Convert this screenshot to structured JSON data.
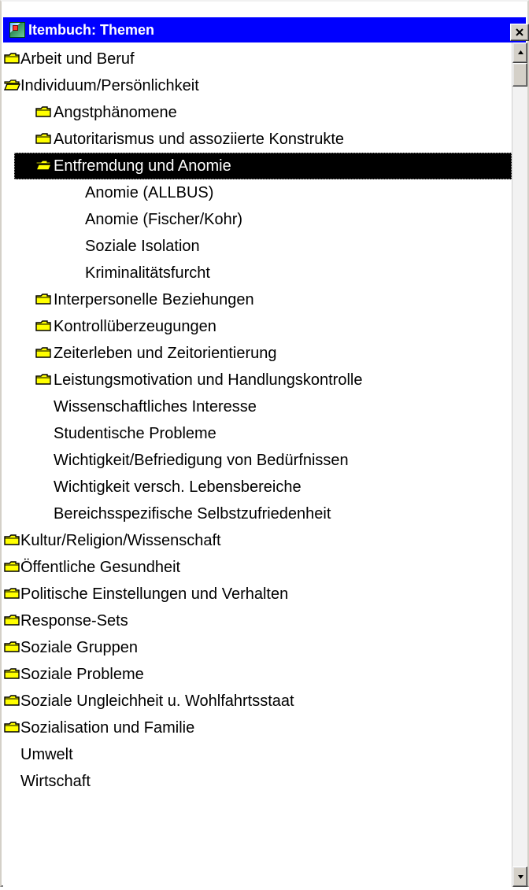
{
  "window": {
    "title": "Itembuch: Themen",
    "icons": {
      "app_icon": "app-icon",
      "close_icon": "close-icon",
      "folder_icon": "folder-icon",
      "folder_open_icon": "folder-open-icon"
    }
  },
  "tree": {
    "items": [
      {
        "label": "Arbeit und Beruf",
        "level": 0,
        "icon": "folder",
        "selected": false
      },
      {
        "label": "Individuum/Persönlichkeit",
        "level": 0,
        "icon": "folder-open",
        "selected": false
      },
      {
        "label": "Angstphänomene",
        "level": 1,
        "icon": "folder",
        "selected": false
      },
      {
        "label": "Autoritarismus und assoziierte Konstrukte",
        "level": 1,
        "icon": "folder",
        "selected": false
      },
      {
        "label": "Entfremdung und Anomie",
        "level": 1,
        "icon": "folder-open",
        "selected": true
      },
      {
        "label": "Anomie (ALLBUS)",
        "level": 2,
        "icon": "none",
        "selected": false
      },
      {
        "label": "Anomie (Fischer/Kohr)",
        "level": 2,
        "icon": "none",
        "selected": false
      },
      {
        "label": "Soziale Isolation",
        "level": 2,
        "icon": "none",
        "selected": false
      },
      {
        "label": "Kriminalitätsfurcht",
        "level": 2,
        "icon": "none",
        "selected": false
      },
      {
        "label": "Interpersonelle Beziehungen",
        "level": 1,
        "icon": "folder",
        "selected": false
      },
      {
        "label": "Kontrollüberzeugungen",
        "level": 1,
        "icon": "folder",
        "selected": false
      },
      {
        "label": "Zeiterleben und Zeitorientierung",
        "level": 1,
        "icon": "folder",
        "selected": false
      },
      {
        "label": "Leistungsmotivation und Handlungskontrolle",
        "level": 1,
        "icon": "folder",
        "selected": false
      },
      {
        "label": "Wissenschaftliches Interesse",
        "level": 1,
        "icon": "none",
        "selected": false
      },
      {
        "label": "Studentische Probleme",
        "level": 1,
        "icon": "none",
        "selected": false
      },
      {
        "label": "Wichtigkeit/Befriedigung von Bedürfnissen",
        "level": 1,
        "icon": "none",
        "selected": false
      },
      {
        "label": "Wichtigkeit versch. Lebensbereiche",
        "level": 1,
        "icon": "none",
        "selected": false
      },
      {
        "label": "Bereichsspezifische Selbstzufriedenheit",
        "level": 1,
        "icon": "none",
        "selected": false
      },
      {
        "label": "Kultur/Religion/Wissenschaft",
        "level": 0,
        "icon": "folder",
        "selected": false
      },
      {
        "label": "Öffentliche Gesundheit",
        "level": 0,
        "icon": "folder",
        "selected": false
      },
      {
        "label": "Politische Einstellungen und Verhalten",
        "level": 0,
        "icon": "folder",
        "selected": false
      },
      {
        "label": "Response-Sets",
        "level": 0,
        "icon": "folder",
        "selected": false
      },
      {
        "label": "Soziale Gruppen",
        "level": 0,
        "icon": "folder",
        "selected": false
      },
      {
        "label": "Soziale Probleme",
        "level": 0,
        "icon": "folder",
        "selected": false
      },
      {
        "label": "Soziale Ungleichheit u. Wohlfahrtsstaat",
        "level": 0,
        "icon": "folder",
        "selected": false
      },
      {
        "label": "Sozialisation und Familie",
        "level": 0,
        "icon": "folder",
        "selected": false
      },
      {
        "label": "Umwelt",
        "level": 0,
        "icon": "none",
        "selected": false
      },
      {
        "label": "Wirtschaft",
        "level": 0,
        "icon": "none",
        "selected": false
      }
    ]
  },
  "scrollbar": {
    "position": 0
  }
}
